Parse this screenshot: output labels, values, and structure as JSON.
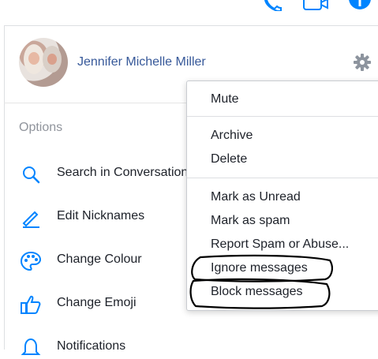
{
  "profile": {
    "name": "Jennifer Michelle Miller"
  },
  "options": {
    "title": "Options",
    "items": [
      {
        "label": "Search in Conversation",
        "icon": "search-icon"
      },
      {
        "label": "Edit Nicknames",
        "icon": "pencil-icon"
      },
      {
        "label": "Change Colour",
        "icon": "palette-icon"
      },
      {
        "label": "Change Emoji",
        "icon": "thumbs-up-icon"
      },
      {
        "label": "Notifications",
        "icon": "bell-icon"
      }
    ]
  },
  "menu": {
    "items": [
      "Mute",
      "Archive",
      "Delete",
      "Mark as Unread",
      "Mark as spam",
      "Report Spam or Abuse...",
      "Ignore messages",
      "Block messages"
    ]
  },
  "colors": {
    "accent": "#0084ff",
    "link": "#365899",
    "muted": "#90949c",
    "annotation": "#000000"
  }
}
